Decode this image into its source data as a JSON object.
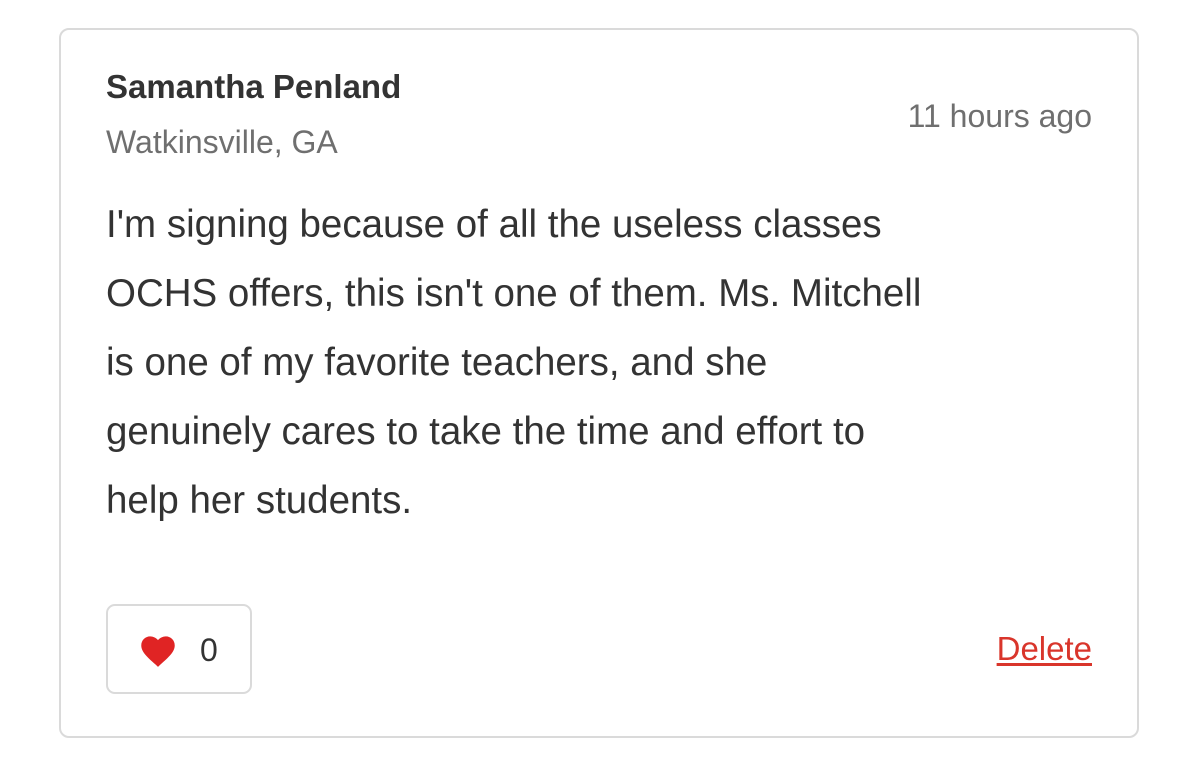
{
  "comment": {
    "author_name": "Samantha Penland",
    "author_location": "Watkinsville, GA",
    "timestamp": "11 hours ago",
    "body_lines": [
      "I'm signing because of all the useless classes",
      "OCHS offers, this isn't one of them. Ms. Mitchell",
      "is one of my favorite teachers, and she",
      "genuinely cares to take the time and effort to",
      "help her students."
    ],
    "like_icon": "heart-icon",
    "like_count": "0",
    "delete_label": "Delete"
  },
  "colors": {
    "text": "#333333",
    "muted_text": "#6f6f6f",
    "border": "#dadada",
    "heart": "#e02424",
    "delete_link": "#d9352b"
  }
}
